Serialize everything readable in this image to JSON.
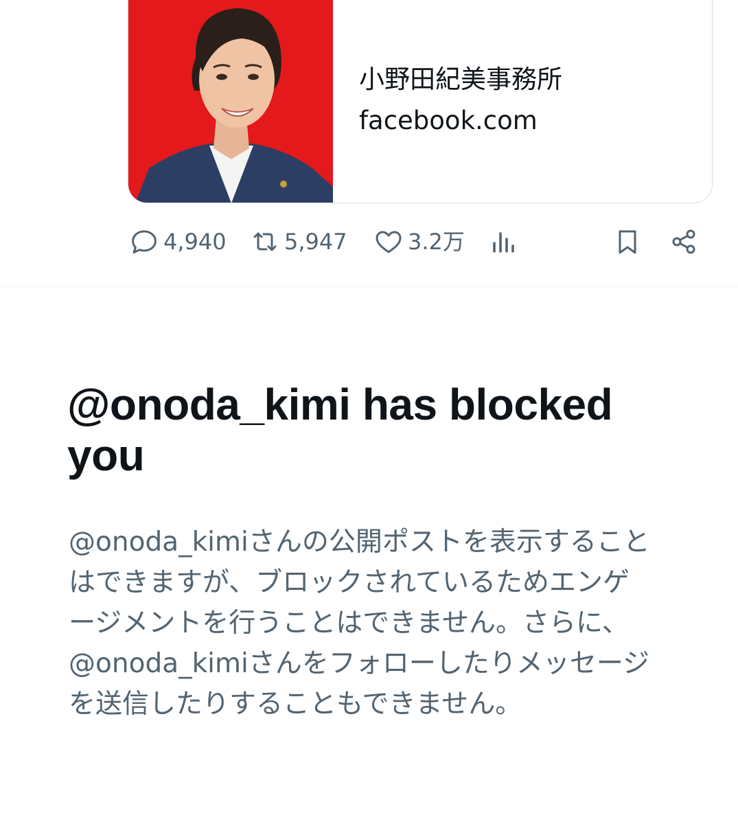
{
  "card": {
    "title": "小野田紀美事務所",
    "domain": "facebook.com",
    "thumb_bg": "#e3191c"
  },
  "actions": {
    "replies": {
      "icon": "reply-icon",
      "count": "4,940"
    },
    "reposts": {
      "icon": "repost-icon",
      "count": "5,947"
    },
    "likes": {
      "icon": "heart-icon",
      "count": "3.2万"
    },
    "views": {
      "icon": "bar-chart-icon"
    },
    "bookmark": {
      "icon": "bookmark-icon"
    },
    "share": {
      "icon": "share-icon"
    }
  },
  "block_notice": {
    "heading": "@onoda_kimi has blocked you",
    "body": "@onoda_kimiさんの公開ポストを表示することはできますが、ブロックされているためエンゲージメントを行うことはできません。さらに、@onoda_kimiさんをフォローしたりメッセージを送信したりすることもできません。"
  },
  "colors": {
    "text_primary": "#0f1419",
    "text_secondary": "#536471",
    "border": "#d7dde2"
  }
}
